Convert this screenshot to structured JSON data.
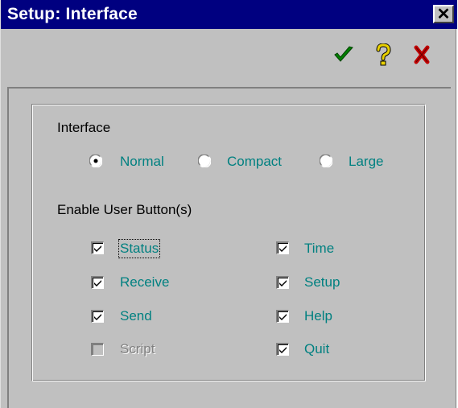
{
  "window": {
    "title": "Setup: Interface",
    "close_label": "✕"
  },
  "toolbar": {
    "ok_icon": "check-icon",
    "help_icon": "help-icon",
    "cancel_icon": "cancel-icon",
    "ok_color": "#008000",
    "help_color": "#c8b400",
    "cancel_color": "#c00000"
  },
  "interface": {
    "heading": "Interface",
    "selected": "Normal",
    "options": [
      {
        "label": "Normal",
        "checked": true
      },
      {
        "label": "Compact",
        "checked": false
      },
      {
        "label": "Large",
        "checked": false
      }
    ]
  },
  "user_buttons": {
    "heading": "Enable User Button(s)",
    "left": [
      {
        "label": "Status",
        "checked": true,
        "enabled": true
      },
      {
        "label": "Receive",
        "checked": true,
        "enabled": true
      },
      {
        "label": "Send",
        "checked": true,
        "enabled": true
      },
      {
        "label": "Script",
        "checked": false,
        "enabled": false
      }
    ],
    "right": [
      {
        "label": "Time",
        "checked": true,
        "enabled": true
      },
      {
        "label": "Setup",
        "checked": true,
        "enabled": true
      },
      {
        "label": "Help",
        "checked": true,
        "enabled": true
      },
      {
        "label": "Quit",
        "checked": true,
        "enabled": true
      }
    ]
  },
  "colors": {
    "titlebar": "#000080",
    "face": "#c0c0c0",
    "option_text": "#008080"
  }
}
